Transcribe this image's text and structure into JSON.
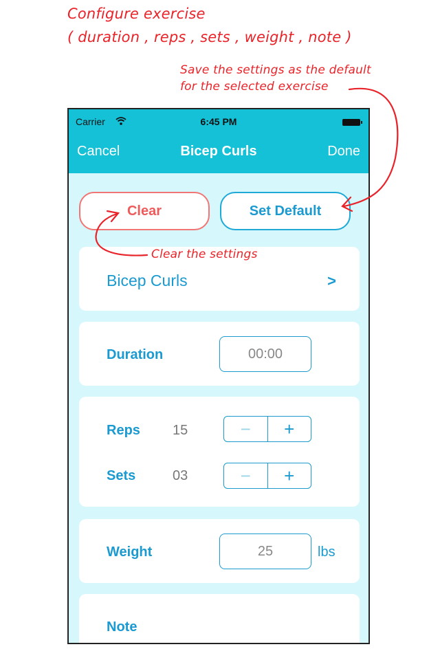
{
  "annotations": {
    "title_line1": "Configure exercise",
    "title_line2": "( duration , reps , sets , weight , note )",
    "set_default_line1": "Save the settings as the default",
    "set_default_line2": "for the selected exercise",
    "clear": "Clear the settings",
    "color": "#e8242a"
  },
  "status_bar": {
    "carrier": "Carrier",
    "time": "6:45 PM"
  },
  "nav": {
    "cancel": "Cancel",
    "title": "Bicep Curls",
    "done": "Done",
    "color": "#14c1d6"
  },
  "actions": {
    "clear": "Clear",
    "set_default": "Set Default"
  },
  "exercise": {
    "name": "Bicep Curls",
    "chevron": ">"
  },
  "duration": {
    "label": "Duration",
    "value": "00:00"
  },
  "reps": {
    "label": "Reps",
    "value": "15"
  },
  "sets": {
    "label": "Sets",
    "value": "03"
  },
  "stepper": {
    "minus": "−",
    "plus": "+"
  },
  "weight": {
    "label": "Weight",
    "value": "25",
    "unit": "lbs"
  },
  "note": {
    "label": "Note"
  }
}
